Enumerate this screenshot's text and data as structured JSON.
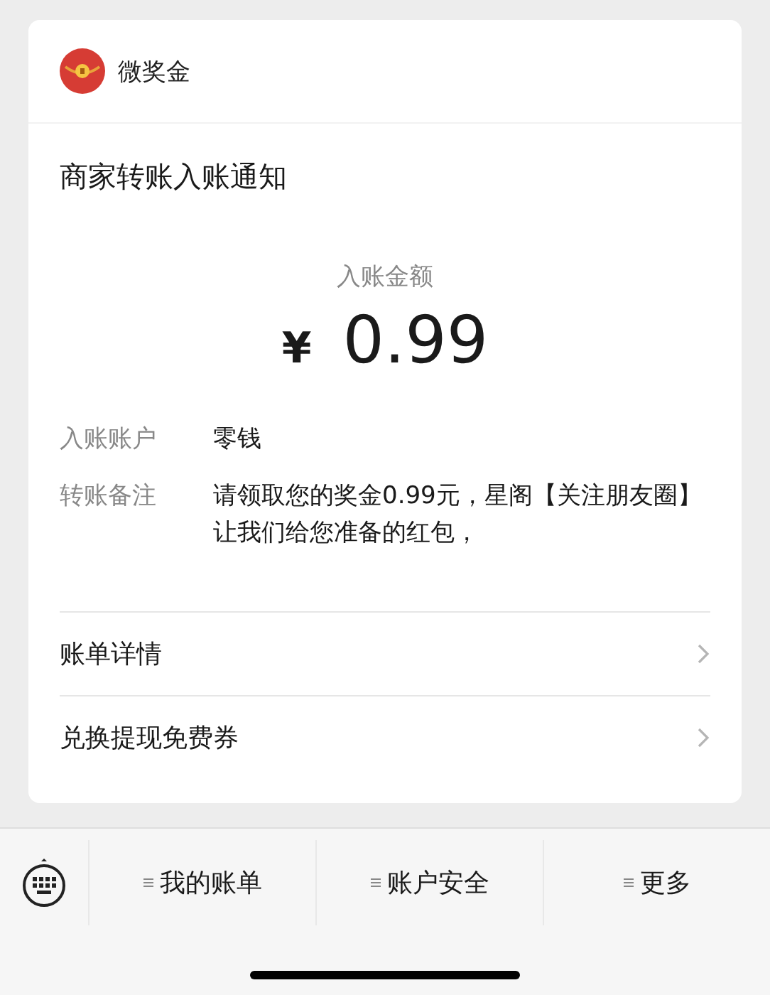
{
  "app": {
    "name": "微奖金"
  },
  "title": "商家转账入账通知",
  "amount": {
    "label": "入账金额",
    "currency": "¥",
    "value": "0.99"
  },
  "details": [
    {
      "label": "入账账户",
      "value": "零钱"
    },
    {
      "label": "转账备注",
      "value": "请领取您的奖金0.99元，星阁【关注朋友圈】让我们给您准备的红包，"
    }
  ],
  "links": [
    {
      "label": "账单详情"
    },
    {
      "label": "兑换提现免费券"
    }
  ],
  "menu": [
    {
      "label": "我的账单"
    },
    {
      "label": "账户安全"
    },
    {
      "label": "更多"
    }
  ]
}
